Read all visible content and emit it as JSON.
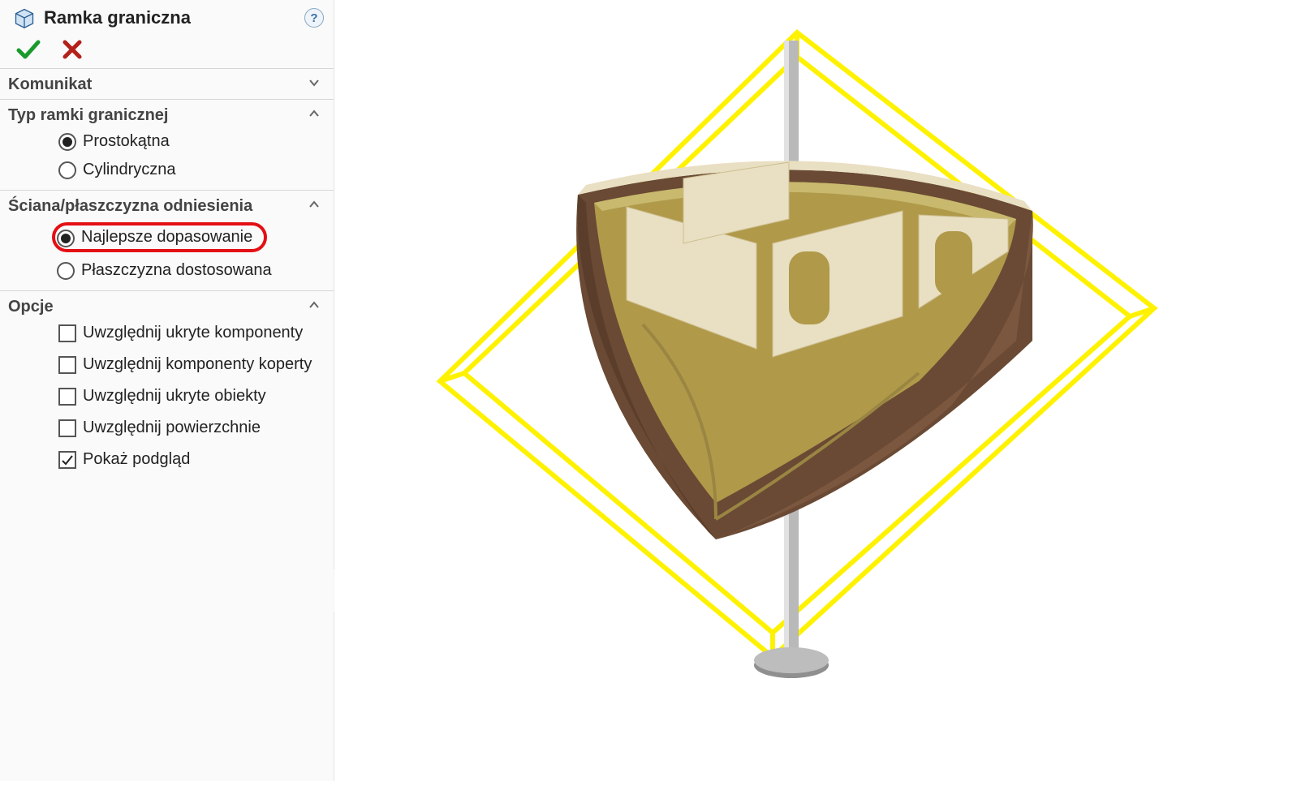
{
  "panel": {
    "title": "Ramka graniczna",
    "help_tooltip": "?"
  },
  "sections": {
    "komunikat": {
      "title": "Komunikat",
      "expanded": false
    },
    "typ": {
      "title": "Typ ramki granicznej",
      "expanded": true,
      "radios": [
        {
          "label": "Prostokątna",
          "selected": true
        },
        {
          "label": "Cylindryczna",
          "selected": false
        }
      ]
    },
    "sciana": {
      "title": "Ściana/płaszczyzna odniesienia",
      "expanded": true,
      "radios": [
        {
          "label": "Najlepsze dopasowanie",
          "selected": true,
          "highlighted": true
        },
        {
          "label": "Płaszczyzna dostosowana",
          "selected": false
        }
      ]
    },
    "opcje": {
      "title": "Opcje",
      "expanded": true,
      "checks": [
        {
          "label": "Uwzględnij ukryte komponenty",
          "checked": false
        },
        {
          "label": "Uwzględnij komponenty koperty",
          "checked": false
        },
        {
          "label": "Uwzględnij ukryte obiekty",
          "checked": false
        },
        {
          "label": "Uwzględnij powierzchnie",
          "checked": false
        },
        {
          "label": "Pokaż podgląd",
          "checked": true
        }
      ]
    }
  }
}
